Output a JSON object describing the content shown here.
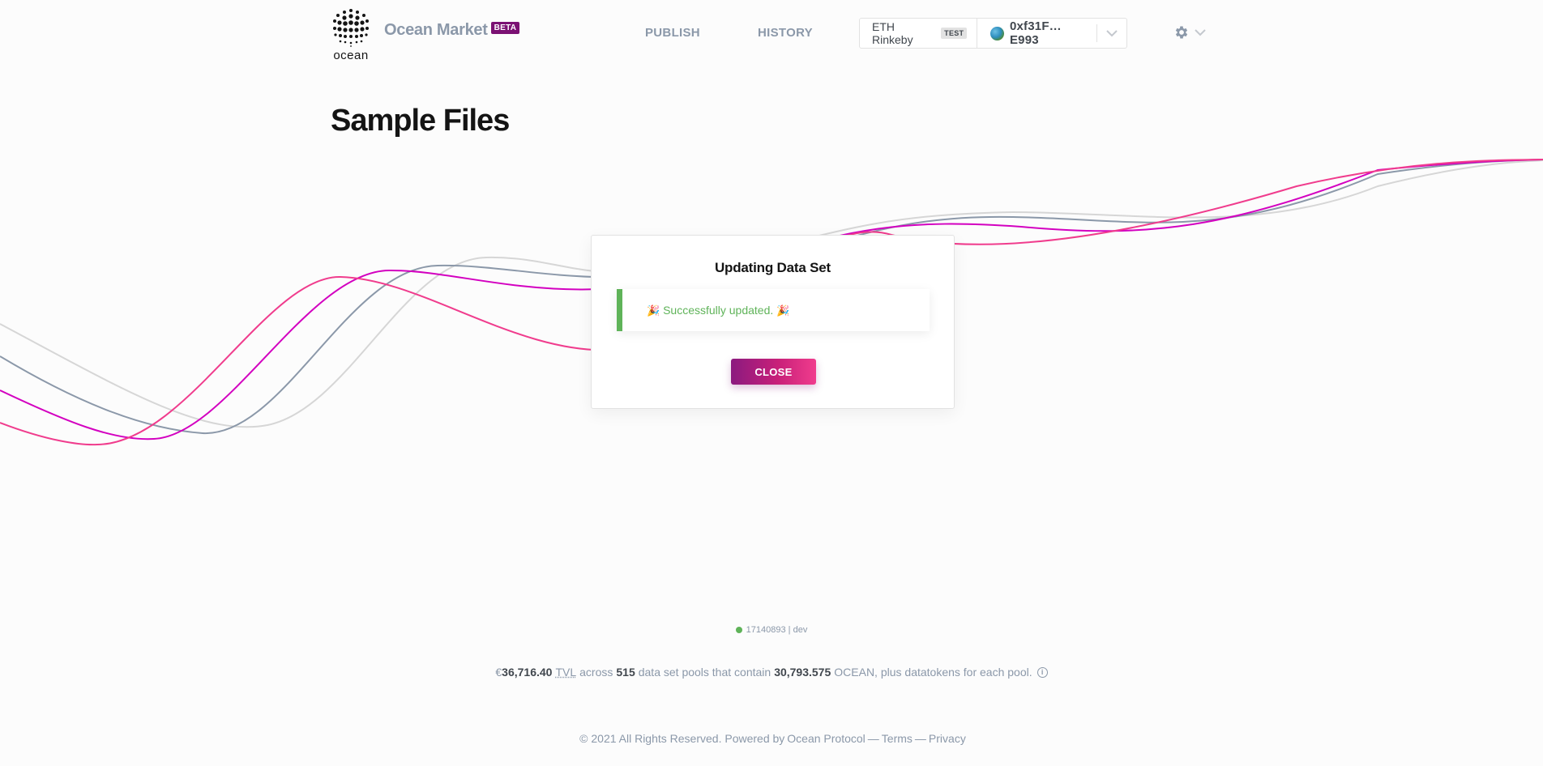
{
  "brand": {
    "logo_word": "ocean",
    "name": "Ocean Market",
    "badge": "BETA"
  },
  "nav": {
    "publish": "PUBLISH",
    "history": "HISTORY"
  },
  "wallet": {
    "network": "ETH Rinkeby",
    "network_badge": "TEST",
    "address": "0xf31F…E993"
  },
  "page": {
    "title": "Sample Files"
  },
  "dialog": {
    "title": "Updating Data Set",
    "success_message": "Successfully updated.",
    "party_emoji": "🎉",
    "close_label": "CLOSE"
  },
  "footer": {
    "build_hash": "17140893",
    "build_sep": "|",
    "build_env": "dev",
    "tvl_currency": "€",
    "tvl_value": "36,716.40",
    "tvl_label": "TVL",
    "across": "across",
    "pool_count": "515",
    "pools_text": "data set pools that contain",
    "ocean_amount": "30,793.575",
    "ocean_text": "OCEAN, plus datatokens for each pool.",
    "info_glyph": "i",
    "copyright": "© 2021 All Rights Reserved. Powered by",
    "powered_by": "Ocean Protocol",
    "dash": "—",
    "terms": "Terms",
    "privacy": "Privacy"
  },
  "colors": {
    "brand_purple": "#7b1173",
    "brand_pink": "#f03c8d",
    "success_green": "#5fb359",
    "muted_text": "#8b98a9"
  },
  "icons": {
    "logo": "ocean-dots-logo",
    "avatar": "globe-avatar",
    "account_menu": "chevron-down-icon",
    "settings": "gear-icon",
    "info": "info-icon"
  }
}
